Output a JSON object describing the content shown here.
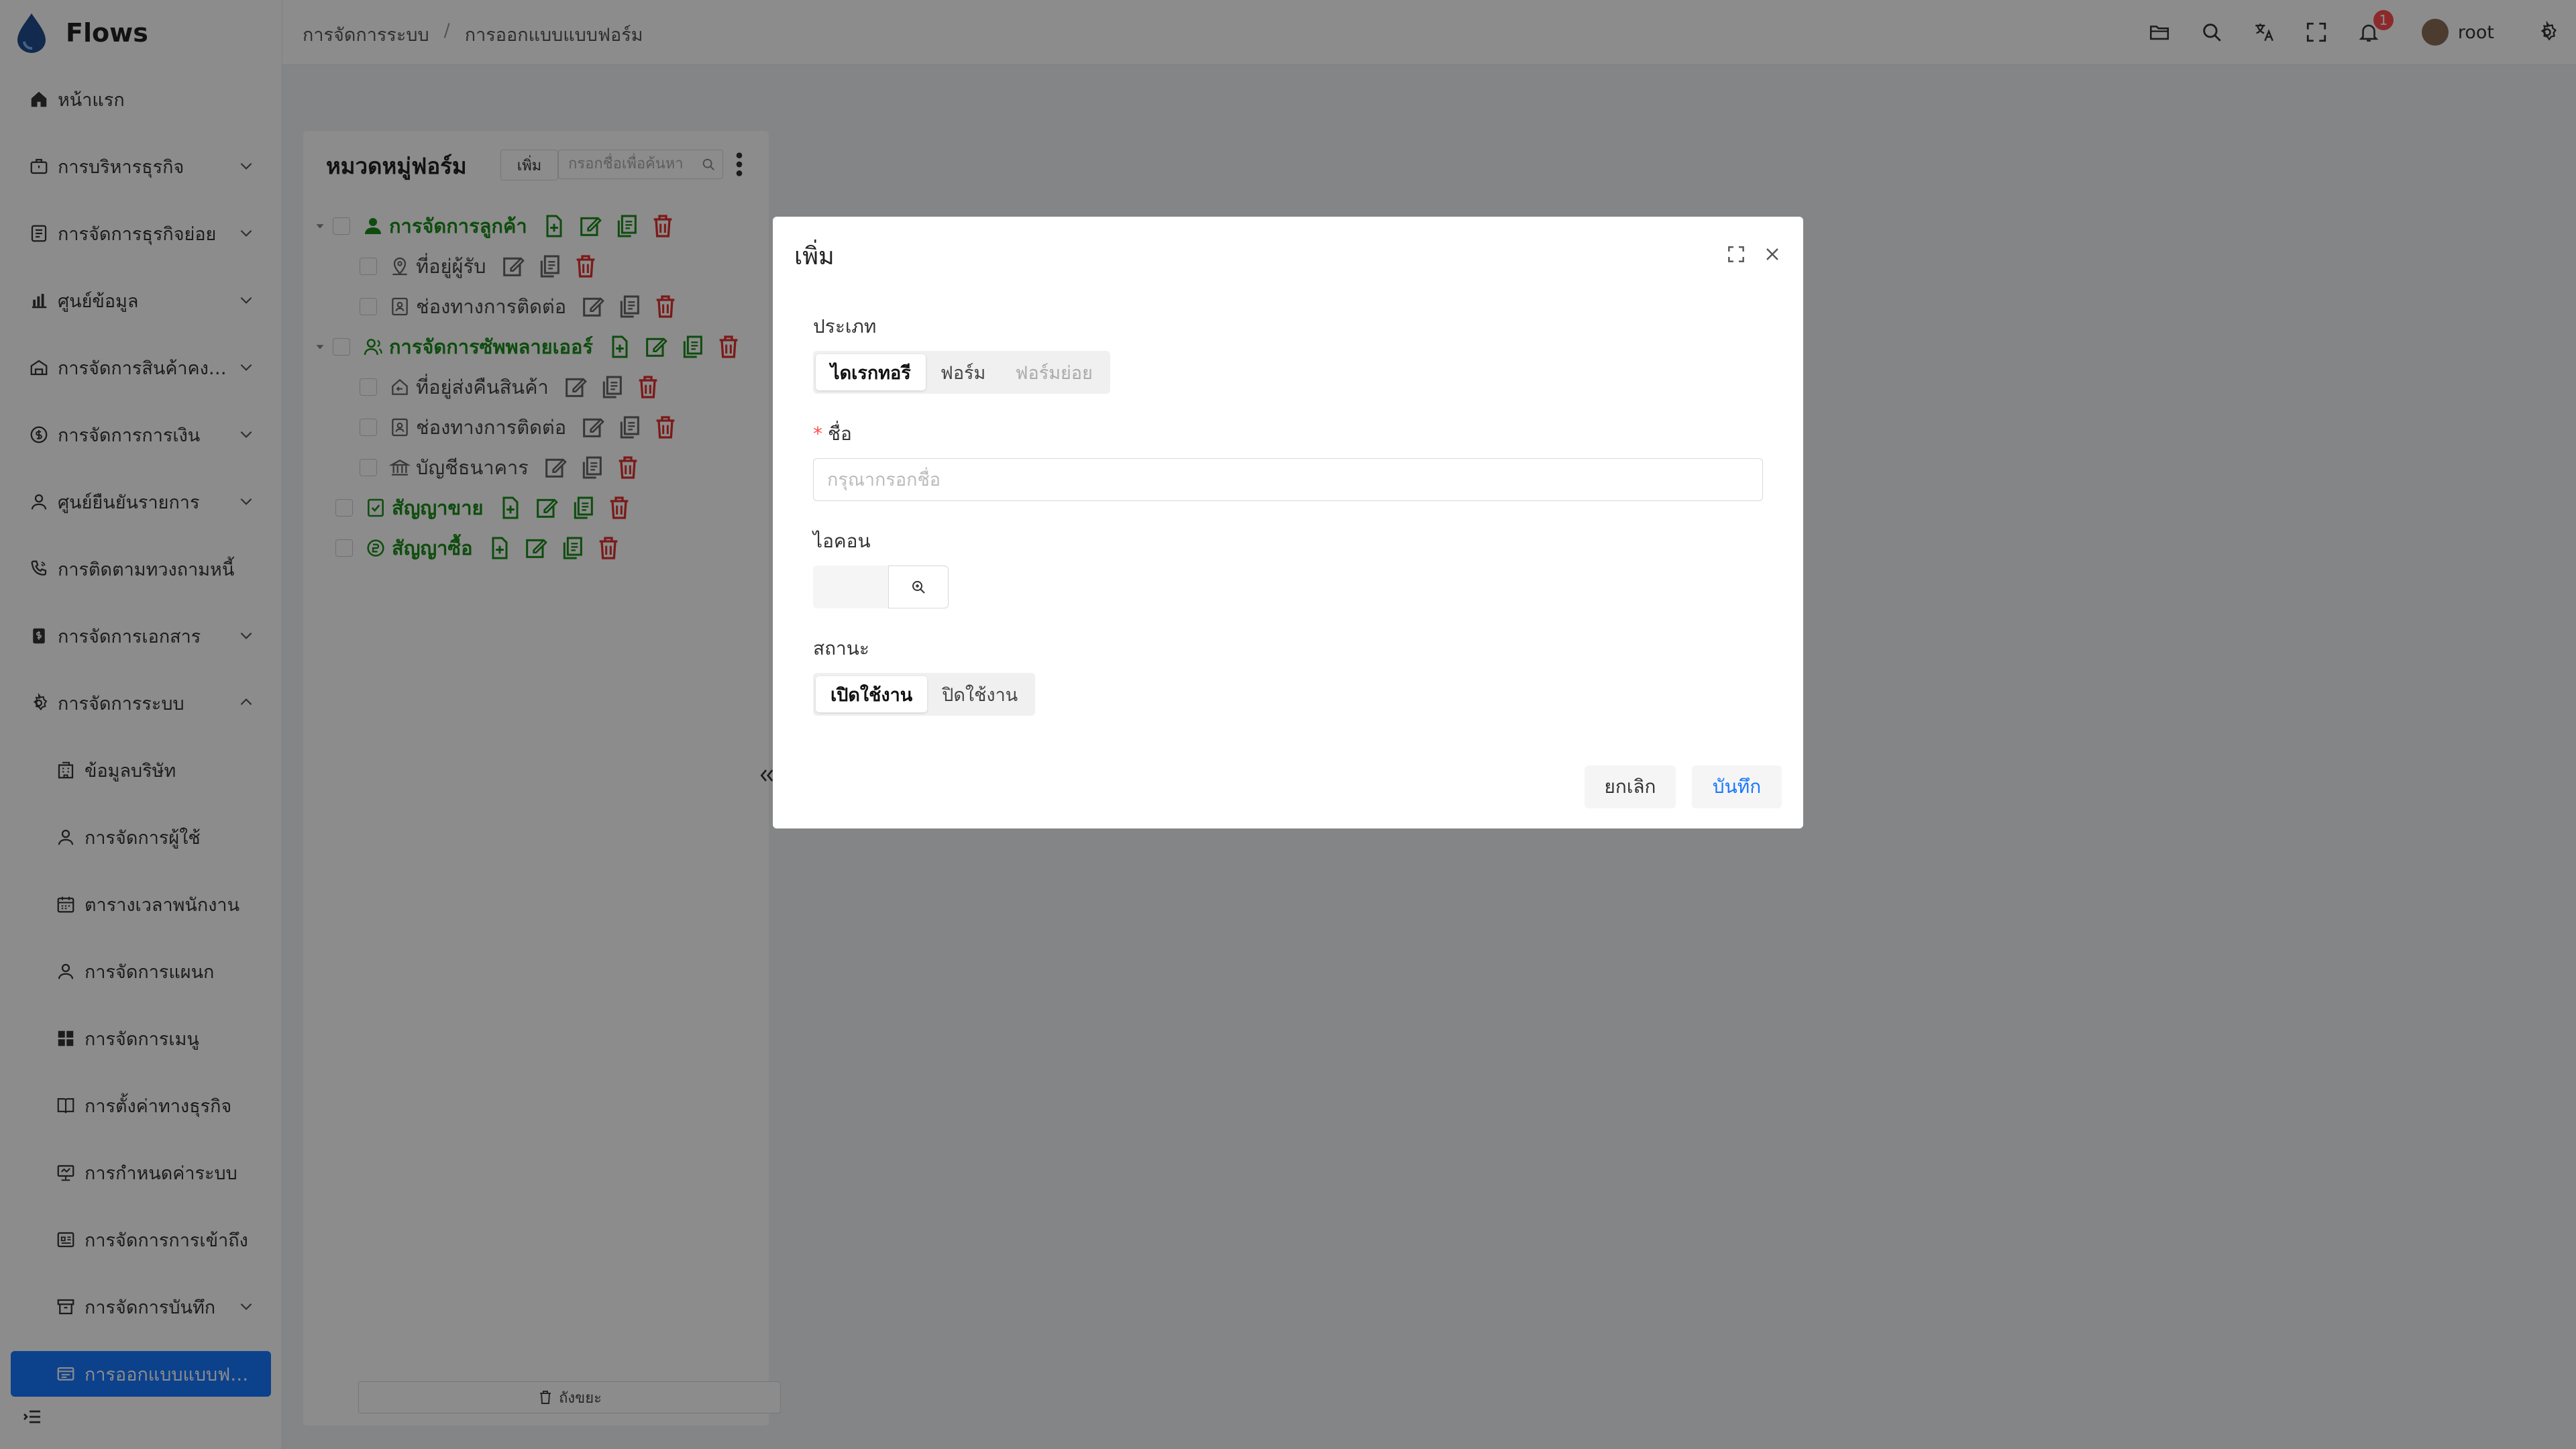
{
  "app": {
    "title": "Flows"
  },
  "sidebar": {
    "items": [
      {
        "label": "หน้าแรก",
        "icon": "home-icon"
      },
      {
        "label": "การบริหารธุรกิจ",
        "icon": "briefcase-icon"
      },
      {
        "label": "การจัดการธุรกิจย่อย",
        "icon": "file-list-icon"
      },
      {
        "label": "ศูนย์ข้อมูล",
        "icon": "bar-chart-icon"
      },
      {
        "label": "การจัดการสินค้าคง…",
        "icon": "warehouse-icon"
      },
      {
        "label": "การจัดการการเงิน",
        "icon": "coin-icon"
      },
      {
        "label": "ศูนย์ยืนยันรายการ",
        "icon": "user-check-icon"
      },
      {
        "label": "การติดตามทวงถามหนี้",
        "icon": "phone-ring-icon"
      },
      {
        "label": "การจัดการเอกสาร",
        "icon": "document-dollar-icon"
      },
      {
        "label": "การจัดการระบบ",
        "icon": "gear-icon"
      }
    ],
    "sub_items": [
      {
        "label": "ข้อมูลบริษัท",
        "icon": "building-icon"
      },
      {
        "label": "การจัดการผู้ใช้",
        "icon": "user-icon"
      },
      {
        "label": "ตารางเวลาพนักงาน",
        "icon": "calendar-icon"
      },
      {
        "label": "การจัดการแผนก",
        "icon": "team-icon"
      },
      {
        "label": "การจัดการเมนู",
        "icon": "grid-icon"
      },
      {
        "label": "การตั้งค่าทางธุรกิจ",
        "icon": "book-icon"
      },
      {
        "label": "การกำหนดค่าระบบ",
        "icon": "monitor-icon"
      },
      {
        "label": "การจัดการการเข้าถึง",
        "icon": "id-card-icon"
      },
      {
        "label": "การจัดการบันทึก",
        "icon": "archive-icon"
      },
      {
        "label": "การออกแบบแบบฟ…",
        "icon": "form-icon"
      }
    ]
  },
  "header": {
    "breadcrumb": [
      "การจัดการระบบ",
      "การออกแบบแบบฟอร์ม"
    ],
    "notification_count": "1",
    "username": "root"
  },
  "tree_panel": {
    "title": "หมวดหมู่ฟอร์ม",
    "add_label": "เพิ่ม",
    "search_placeholder": "กรอกชื่อเพื่อค้นหา",
    "nodes": [
      {
        "label": "การจัดการลูกค้า",
        "level": 0,
        "icon": "user-icon"
      },
      {
        "label": "ที่อยู่ผู้รับ",
        "level": 1,
        "icon": "location-icon"
      },
      {
        "label": "ช่องทางการติดต่อ",
        "level": 1,
        "icon": "contact-card-icon"
      },
      {
        "label": "การจัดการซัพพลายเออร์",
        "level": 0,
        "icon": "supplier-icon"
      },
      {
        "label": "ที่อยู่ส่งคืนสินค้า",
        "level": 1,
        "icon": "return-location-icon"
      },
      {
        "label": "ช่องทางการติดต่อ",
        "level": 1,
        "icon": "contact-card-icon"
      },
      {
        "label": "บัญชีธนาคาร",
        "level": 1,
        "icon": "bank-icon"
      },
      {
        "label": "สัญญาขาย",
        "level": 0,
        "icon": "contract-icon"
      },
      {
        "label": "สัญญาซื้อ",
        "level": 0,
        "icon": "purchase-icon"
      }
    ],
    "trash_label": "ถังขยะ"
  },
  "modal": {
    "title": "เพิ่ม",
    "type_label": "ประเภท",
    "type_options": [
      "ไดเรกทอรี",
      "ฟอร์ม",
      "ฟอร์มย่อย"
    ],
    "type_selected": "ไดเรกทอรี",
    "name_label": "ชื่อ",
    "name_placeholder": "กรุณากรอกชื่อ",
    "name_value": "",
    "icon_label": "ไอคอน",
    "status_label": "สถานะ",
    "status_options": [
      "เปิดใช้งาน",
      "ปิดใช้งาน"
    ],
    "status_selected": "เปิดใช้งาน",
    "cancel_label": "ยกเลิก",
    "save_label": "บันทึก"
  },
  "colors": {
    "accent": "#1677ff",
    "tree_green": "#1b8a1b",
    "danger": "#e0312f"
  }
}
